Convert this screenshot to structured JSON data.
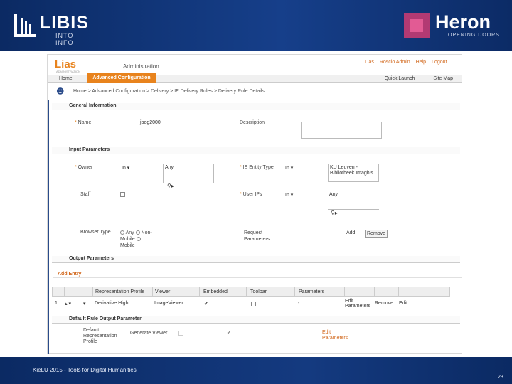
{
  "slide": {
    "footer": "KieLU 2015 - Tools for Digital Humanities",
    "page_number": "23"
  },
  "logos": {
    "libis_name": "LIBIS",
    "libis_tagline": "INTO INFO",
    "heron_name": "Heron",
    "heron_tagline": "OPENING DOORS"
  },
  "app": {
    "brand": "Lias",
    "brand_sub": "ADMINISTRATION",
    "section_title": "Administration",
    "top_links": [
      "Lias",
      "Roscio Admin",
      "Help",
      "Logout"
    ],
    "nav": {
      "home": "Home",
      "active_tab": "Advanced Configuration",
      "quick_launch": "Quick Launch",
      "site_map": "Site Map"
    },
    "breadcrumb": "Home > Advanced Configuration > Delivery > IE Delivery Rules > Delivery Rule Details"
  },
  "general": {
    "title": "General Information",
    "name_label": "Name",
    "name_value": "jpeg2000",
    "description_label": "Description"
  },
  "input": {
    "title": "Input Parameters",
    "owner_label": "Owner",
    "owner_op": "In",
    "owner_value": "Any",
    "ie_entity_label": "IE Entity Type",
    "ie_entity_op": "In",
    "ie_entity_value": "KU Leuven - Bibliotheek Imaghis",
    "staff_label": "Staff",
    "user_ips_label": "User IPs",
    "user_ips_op": "In",
    "user_ips_value": "Any",
    "browser_label": "Browser Type",
    "browser_any": "Any",
    "browser_nonmobile": "Non-Mobile",
    "browser_mobile": "Mobile",
    "request_label": "Request Parameters",
    "add_button": "Add",
    "remove_button": "Remove"
  },
  "output": {
    "title": "Output Parameters",
    "add_entry": "Add Entry",
    "columns": [
      "Representation Profile",
      "Viewer",
      "Embedded",
      "Toolbar",
      "Parameters"
    ],
    "row": {
      "index": "1",
      "profile": "Derivative High",
      "viewer": "ImageViewer",
      "parameters": "-",
      "edit_parameters": "Edit Parameters",
      "remove": "Remove",
      "edit": "Edit"
    }
  },
  "default_rule": {
    "title": "Default Rule Output Parameter",
    "profile_label": "Default Representation Profile",
    "viewer_label": "Generate Viewer",
    "edit_parameters": "Edit Parameters"
  }
}
